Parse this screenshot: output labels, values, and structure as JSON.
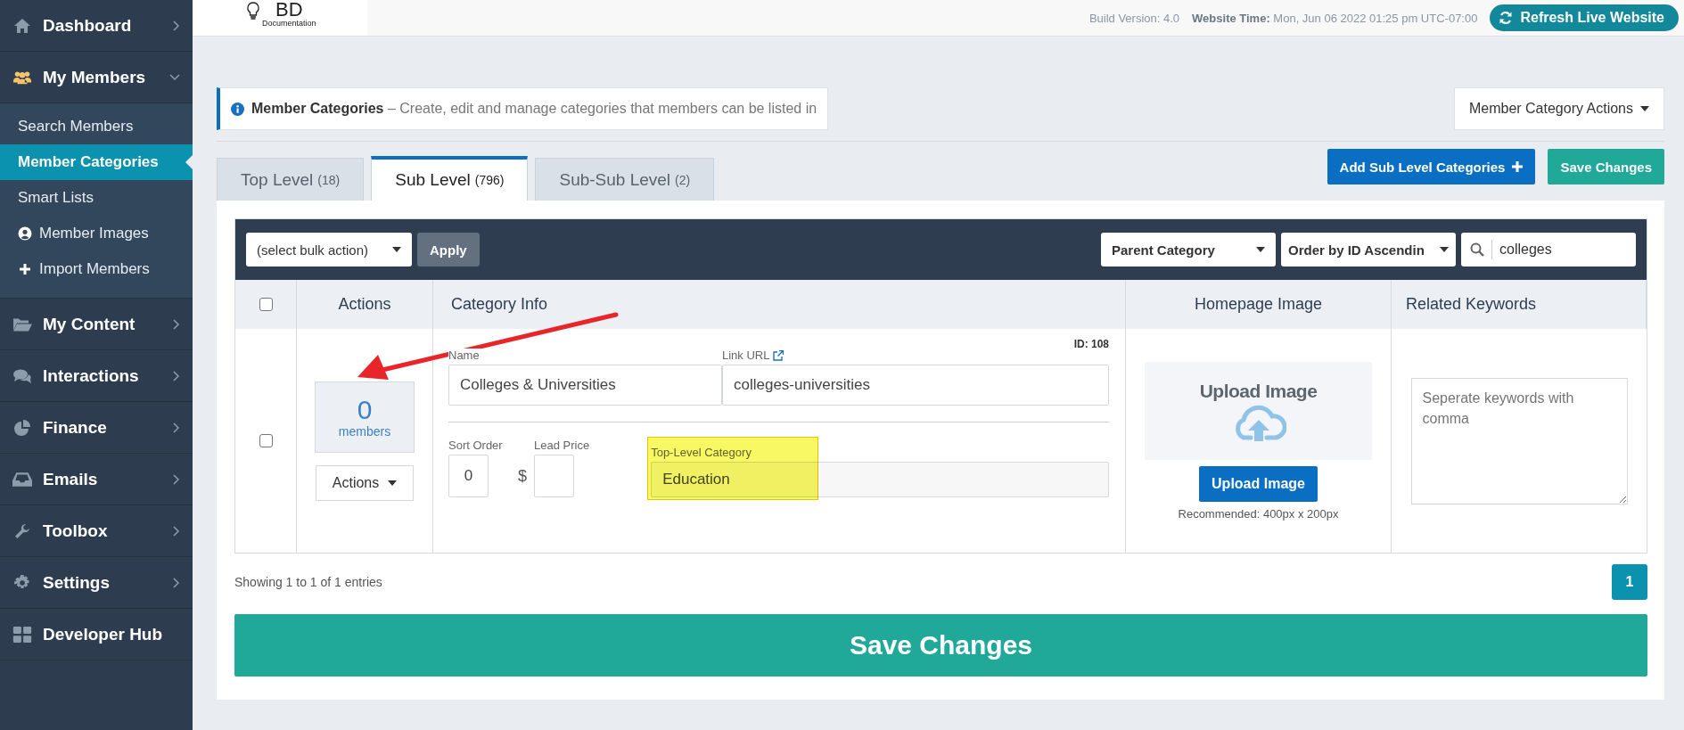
{
  "sidebar": {
    "items": [
      {
        "label": "Dashboard",
        "kind": "menu",
        "expanded": false
      },
      {
        "label": "My Members",
        "kind": "menu",
        "expanded": true,
        "children": [
          {
            "label": "Search Members",
            "selected": false
          },
          {
            "label": "Member Categories",
            "selected": true
          },
          {
            "label": "Smart Lists",
            "selected": false
          },
          {
            "label": "Member Images",
            "selected": false
          },
          {
            "label": "Import Members",
            "selected": false
          }
        ]
      },
      {
        "label": "My Content",
        "kind": "menu",
        "expanded": false
      },
      {
        "label": "Interactions",
        "kind": "menu",
        "expanded": false
      },
      {
        "label": "Finance",
        "kind": "menu",
        "expanded": false
      },
      {
        "label": "Emails",
        "kind": "menu",
        "expanded": false
      },
      {
        "label": "Toolbox",
        "kind": "menu",
        "expanded": false
      },
      {
        "label": "Settings",
        "kind": "menu",
        "expanded": false
      },
      {
        "label": "Developer Hub",
        "kind": "link"
      }
    ]
  },
  "top_bar": {
    "logo_text": "BD",
    "logo_subtext": "Documentation",
    "build_version": "Build Version: 4.0",
    "website_time_label": "Website Time:",
    "website_time": "Mon, Jun 06 2022 01:25 pm UTC-07:00",
    "refresh_button": "Refresh Live Website"
  },
  "header": {
    "info_title": "Member Categories",
    "info_text": "– Create, edit and manage categories that members can be listed in",
    "actions_button": "Member Category Actions"
  },
  "tabs": [
    {
      "label": "Top Level",
      "count": "(18)",
      "selected": false
    },
    {
      "label": "Sub Level",
      "count": "(796)",
      "selected": true
    },
    {
      "label": "Sub-Sub Level",
      "count": "(2)",
      "selected": false
    }
  ],
  "buttons": {
    "add": "Add Sub Level Categories",
    "save": "Save Changes"
  },
  "toolbar": {
    "bulk_select": "(select bulk action)",
    "apply": "Apply",
    "parent_filter": "Parent Category",
    "order_select": "Order by ID Ascendin",
    "search": "colleges"
  },
  "table": {
    "header_checked": false,
    "columns": [
      "Actions",
      "Category Info",
      "Homepage Image",
      "Related Keywords"
    ],
    "rows": [
      {
        "checked": false,
        "member_count": "0",
        "member_label": "members",
        "actions_button": "Actions",
        "id": "ID: 108",
        "name_label": "Name",
        "name": "Colleges & Universities",
        "link_label": "Link URL",
        "link": "colleges-universities",
        "sort_label": "Sort Order",
        "sort_order": "0",
        "lead_label": "Lead Price",
        "currency": "$",
        "top_level_label": "Top-Level Category",
        "top_level": "Education",
        "upload_title": "Upload Image",
        "upload_button": "Upload Image",
        "recommended": "Recommended: 400px x 200px",
        "keywords_placeholder": "Seperate keywords with comma"
      }
    ]
  },
  "footer": {
    "showing": "Showing 1 to 1 of 1 entries",
    "pages": [
      {
        "label": "1",
        "selected": true
      }
    ],
    "save_all": "Save Changes"
  }
}
